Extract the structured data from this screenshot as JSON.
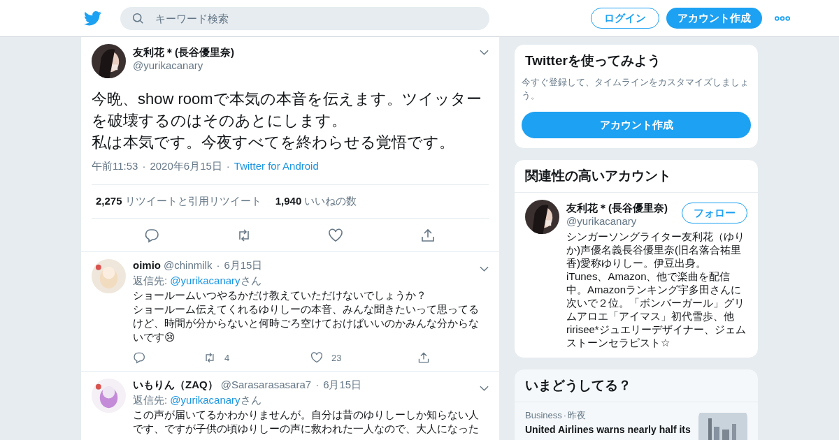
{
  "header": {
    "search": {
      "placeholder": "キーワード検索"
    },
    "login": "ログイン",
    "signup": "アカウント作成"
  },
  "tweet": {
    "name": "友利花＊(長谷優里奈)",
    "handle": "@yurikacanary",
    "lines": [
      "今晩、show roomで本気の本音を伝えます。ツイッターを破壊するのはそのあとにします。",
      "私は本気です。今夜すべてを終わらせる覚悟です。"
    ],
    "separator": "·",
    "time": "午前11:53",
    "date": "2020年6月15日",
    "source": "Twitter for Android",
    "retweets": "2,275",
    "retweets_label": "リツイートと引用リツイート",
    "likes": "1,940",
    "likes_label": "いいねの数"
  },
  "replies": [
    {
      "name": "oimio",
      "handle": "@chinmilk",
      "date": "6月15日",
      "reply_label": "返信先:",
      "reply_to": "@yurikacanary",
      "reply_suffix": "さん",
      "separator": "·",
      "lines": [
        "ショールームいつやるかだけ教えていただけないでしょうか？",
        "ショールーム伝えてくれるゆりしーの本音、みんな聞きたいって思ってるけど、時間が分からないと何時ごろ空けておけばいいのかみんな分からないです😢"
      ],
      "retweets": "4",
      "likes": "23"
    },
    {
      "name": "いもりん（ZAQ）",
      "handle": "@Sarasarasasara7",
      "date": "6月15日",
      "reply_label": "返信先:",
      "reply_to": "@yurikacanary",
      "reply_suffix": "さん",
      "separator": "·",
      "lines": [
        "この声が届いてるかわかりませんが。自分は昔のゆりしーしか知らない人です、ですが子供の頃ゆりしーの声に救われた一人なので、大人になった"
      ]
    }
  ],
  "signup_card": {
    "title": "Twitterを使ってみよう",
    "text": "今すぐ登録して、タイムラインをカスタマイズしましょう。",
    "button": "アカウント作成"
  },
  "related": {
    "title": "関連性の高いアカウント",
    "accounts": [
      {
        "name": "友利花＊(長谷優里奈)",
        "handle": "@yurikacanary",
        "follow": "フォロー",
        "bio": "シンガーソングライター友利花（ゆりか)声優名義長谷優里奈(旧名落合祐里香)愛称ゆりしー。伊豆出身。iTunes、Amazon、他で楽曲を配信中。Amazonランキング宇多田さんに次いで２位。「ボンバーガール」グリムアロエ「アイマス」初代雪歩、他ririsee*ジュエリーデザイナー、ジェムストーンセラピスト☆"
      }
    ]
  },
  "trends": {
    "title": "いまどうしてる？",
    "items": [
      {
        "category": "Business",
        "separator": "·",
        "time": "昨夜",
        "headline": "United Airlines warns nearly half its",
        "kind": "picture"
      }
    ]
  }
}
